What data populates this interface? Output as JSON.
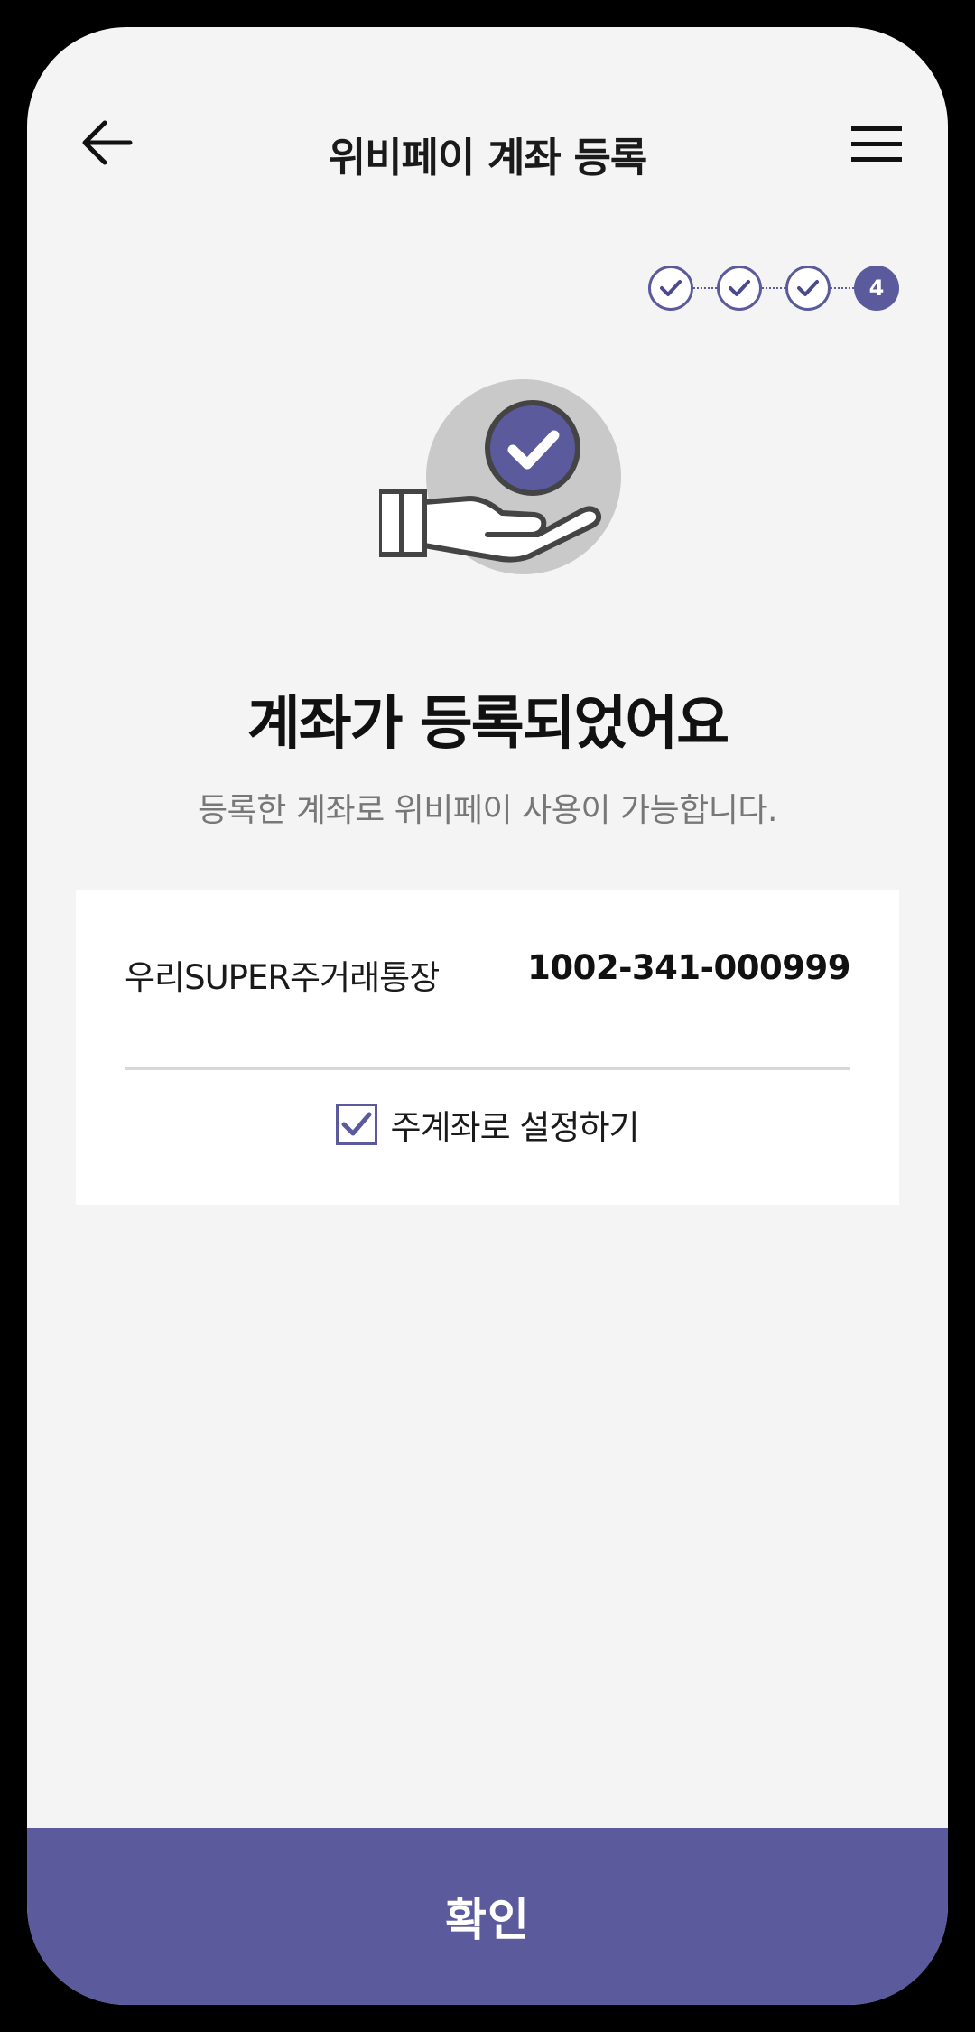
{
  "header": {
    "title": "위비페이 계좌 등록",
    "back_icon": "arrow-left-icon",
    "menu_icon": "hamburger-menu-icon"
  },
  "steps": {
    "total": 4,
    "current_label": "4",
    "completed": 3
  },
  "hero": {
    "icon": "hand-with-check-icon",
    "headline": "계좌가 등록되었어요",
    "subtext": "등록한 계좌로 위비페이 사용이 가능합니다."
  },
  "account": {
    "name": "우리SUPER주거래통장",
    "number": "1002-341-000999",
    "set_main_label": "주계좌로 설정하기",
    "set_main_checked": true
  },
  "footer": {
    "confirm_label": "확인"
  },
  "colors": {
    "accent": "#5a5a9c",
    "background": "#f4f4f4",
    "card": "#ffffff"
  }
}
